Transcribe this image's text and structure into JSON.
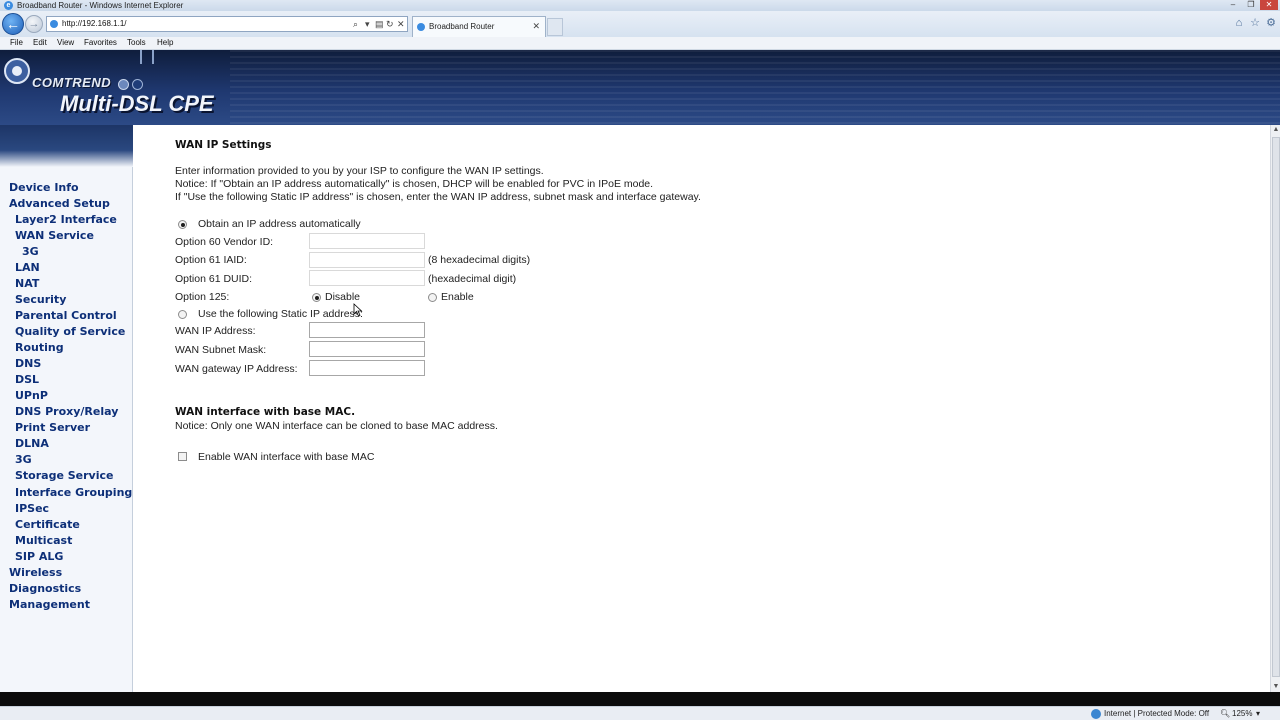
{
  "window": {
    "title": "Broadband Router - Windows Internet Explorer",
    "address": "http://192.168.1.1/",
    "tab_label": "Broadband Router"
  },
  "menu": [
    "File",
    "Edit",
    "View",
    "Favorites",
    "Tools",
    "Help"
  ],
  "header": {
    "brand": "COMTREND",
    "product": "Multi-DSL CPE"
  },
  "sidebar": {
    "items": [
      {
        "label": "Device Info"
      },
      {
        "label": "Advanced Setup"
      },
      {
        "label": "Layer2 Interface"
      },
      {
        "label": "WAN Service"
      },
      {
        "label": "3G"
      },
      {
        "label": "LAN"
      },
      {
        "label": "NAT"
      },
      {
        "label": "Security"
      },
      {
        "label": "Parental Control"
      },
      {
        "label": "Quality of Service"
      },
      {
        "label": "Routing"
      },
      {
        "label": "DNS"
      },
      {
        "label": "DSL"
      },
      {
        "label": "UPnP"
      },
      {
        "label": "DNS Proxy/Relay"
      },
      {
        "label": "Print Server"
      },
      {
        "label": "DLNA"
      },
      {
        "label": "3G"
      },
      {
        "label": "Storage Service"
      },
      {
        "label": "Interface Grouping"
      },
      {
        "label": "IPSec"
      },
      {
        "label": "Certificate"
      },
      {
        "label": "Multicast"
      },
      {
        "label": "SIP ALG"
      },
      {
        "label": "Wireless"
      },
      {
        "label": "Diagnostics"
      },
      {
        "label": "Management"
      }
    ]
  },
  "main": {
    "title": "WAN IP Settings",
    "intro": [
      "Enter information provided to you by your ISP to configure the WAN IP settings.",
      "Notice: If \"Obtain an IP address automatically\" is chosen, DHCP will be enabled for PVC in IPoE mode.",
      "If \"Use the following Static IP address\" is chosen, enter the WAN IP address, subnet mask and interface gateway."
    ],
    "auto_option_label": "Obtain an IP address automatically",
    "option60_label": "Option 60 Vendor ID:",
    "option60_value": "",
    "option61_iaid_label": "Option 61 IAID:",
    "option61_iaid_value": "",
    "option61_iaid_hint": "(8 hexadecimal digits)",
    "option61_duid_label": "Option 61 DUID:",
    "option61_duid_value": "",
    "option61_duid_hint": "(hexadecimal digit)",
    "option125_label": "Option 125:",
    "option125_disable": "Disable",
    "option125_enable": "Enable",
    "static_option_label": "Use the following Static IP address:",
    "wan_ip_label": "WAN IP Address:",
    "wan_ip_value": "",
    "subnet_label": "WAN Subnet Mask:",
    "subnet_value": "",
    "gateway_label": "WAN gateway IP Address:",
    "gateway_value": "",
    "mac_title": "WAN interface with base MAC.",
    "mac_notice": "Notice: Only one WAN interface can be cloned to base MAC address.",
    "mac_checkbox_label": "Enable WAN interface with base MAC"
  },
  "status": {
    "zone": "Internet | Protected Mode: Off",
    "zoom": "125%"
  },
  "colors": {
    "header_dark": "#0f1d3c",
    "nav_text": "#0d2f78",
    "sidebar_bg": "#f3f6fb"
  }
}
